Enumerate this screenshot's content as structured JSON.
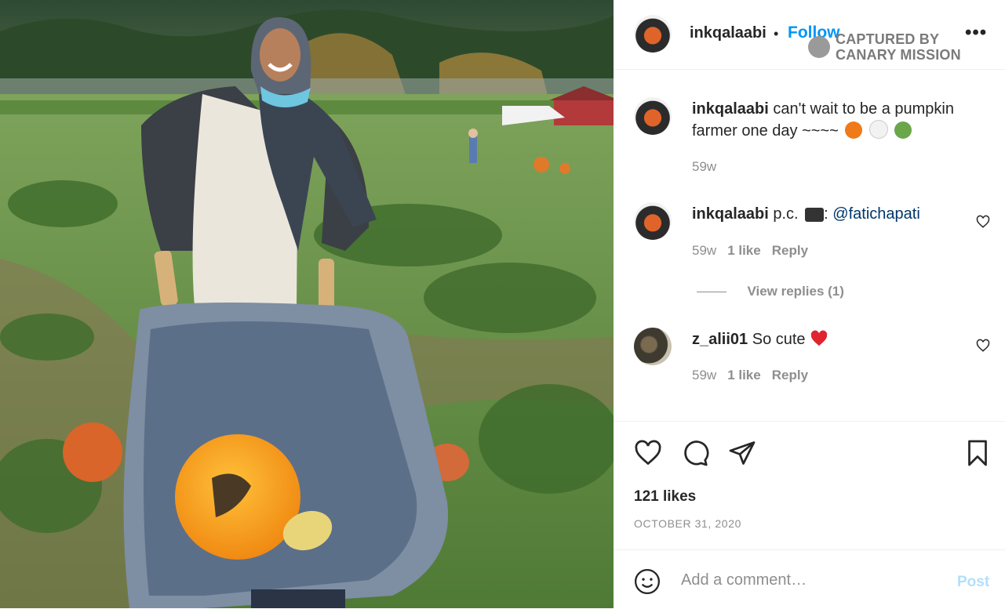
{
  "post": {
    "username": "inkqalaabi",
    "follow_label": "Follow",
    "separator": "•",
    "more_label": "•••",
    "watermark": {
      "line1": "CAPTURED BY",
      "line2": "CANARY MISSION"
    },
    "caption": {
      "username": "inkqalaabi",
      "text": "can't wait to be a pumpkin farmer one day ~~~~",
      "age": "59w"
    },
    "comments": [
      {
        "username": "inkqalaabi",
        "text_prefix": "p.c. ",
        "text_suffix": ": ",
        "mention": "@fatichapati",
        "age": "59w",
        "likes": "1 like",
        "reply": "Reply"
      },
      {
        "username": "z_alii01",
        "text": "So cute",
        "age": "59w",
        "likes": "1 like",
        "reply": "Reply"
      }
    ],
    "view_replies": "View replies (1)",
    "likes_count": "121 likes",
    "date": "OCTOBER 31, 2020",
    "add_comment_placeholder": "Add a comment…",
    "post_button": "Post"
  },
  "icons": {
    "like": "heart-icon",
    "comment": "comment-icon",
    "share": "paper-plane-icon",
    "save": "bookmark-icon",
    "emoji": "smiley-icon"
  },
  "colors": {
    "follow": "#0095f6",
    "post_disabled": "#b2dffc",
    "mention": "#00376b",
    "muted": "#8e8e8e"
  }
}
